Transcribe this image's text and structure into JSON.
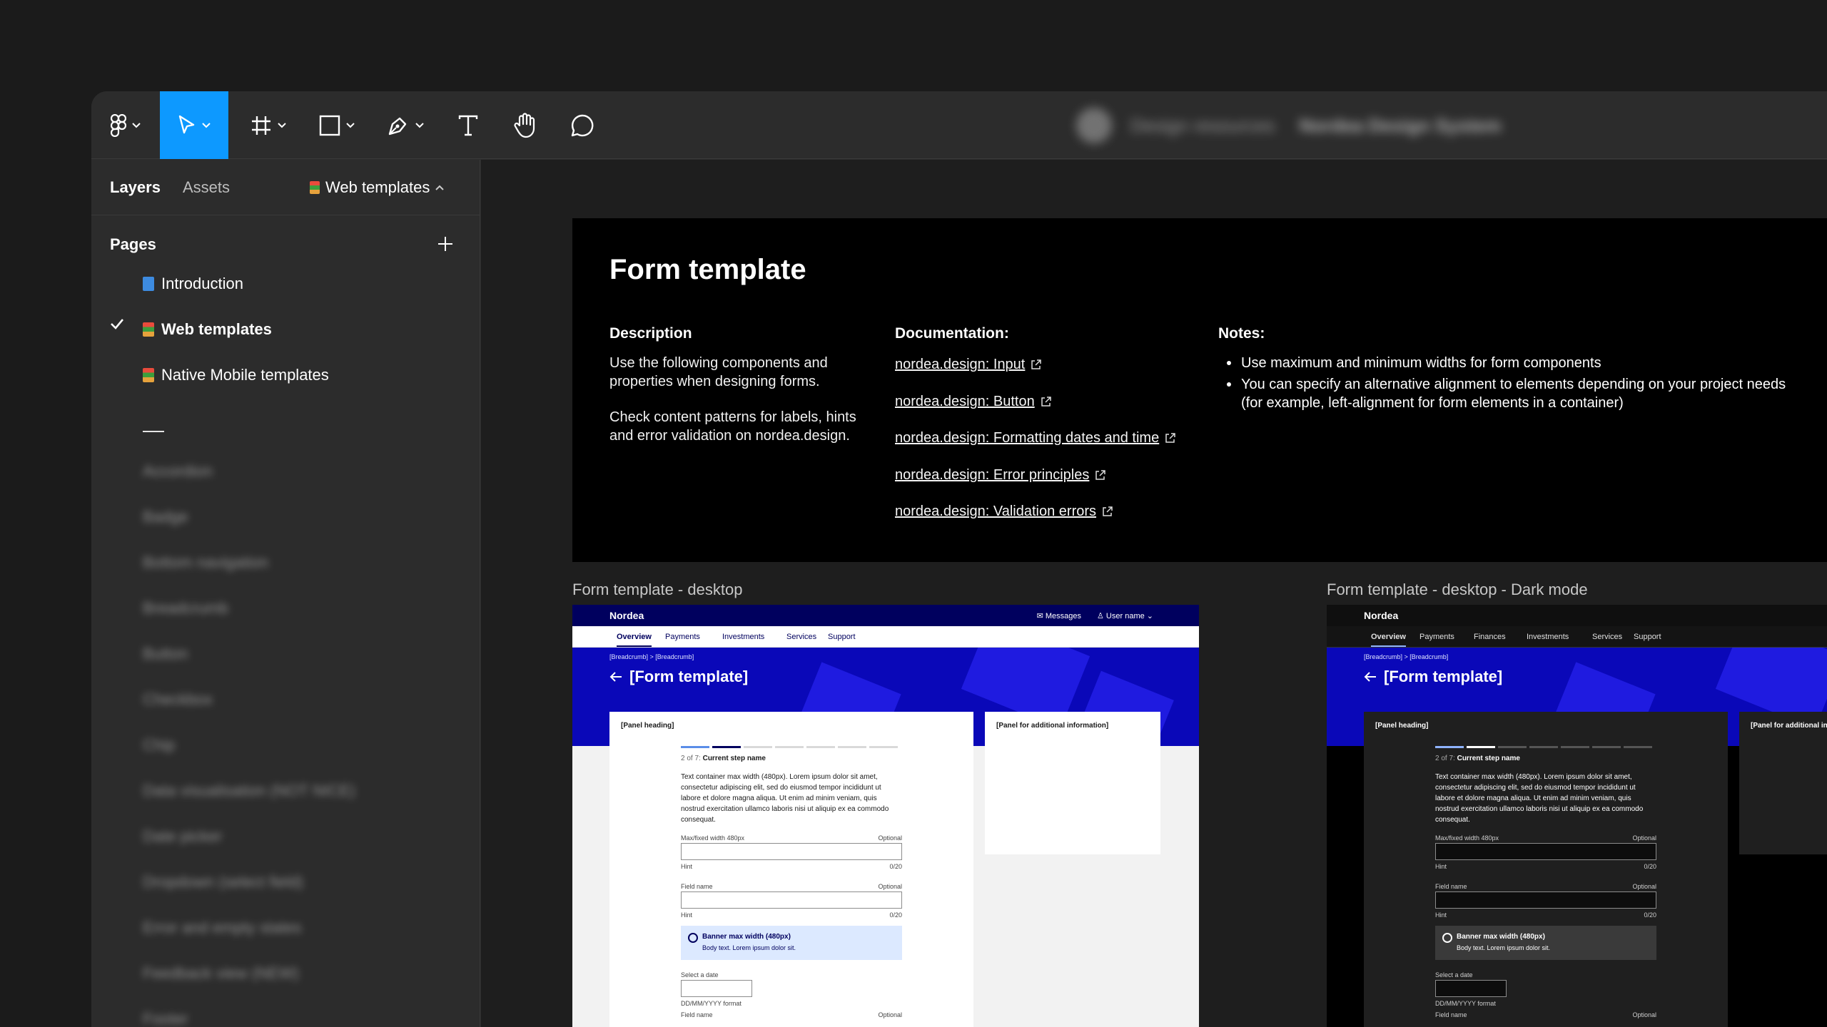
{
  "toolbar": {
    "tools": [
      {
        "name": "main-menu",
        "icon": "figma-logo-icon",
        "active": false
      },
      {
        "name": "move",
        "icon": "cursor-icon",
        "active": true
      },
      {
        "name": "frame",
        "icon": "frame-icon",
        "active": false
      },
      {
        "name": "shape",
        "icon": "rectangle-icon",
        "active": false
      },
      {
        "name": "pen",
        "icon": "pen-icon",
        "active": false
      },
      {
        "name": "text",
        "icon": "text-icon",
        "active": false
      },
      {
        "name": "hand",
        "icon": "hand-icon",
        "active": false
      },
      {
        "name": "comment",
        "icon": "comment-icon",
        "active": false
      }
    ],
    "accent_color": "#0d99ff",
    "file_team": "Design resources",
    "file_name": "Nordea Design System"
  },
  "sidebar": {
    "tab_layers": "Layers",
    "tab_assets": "Assets",
    "current_page": "Web templates",
    "pages_title": "Pages",
    "pages": [
      {
        "label": "Introduction",
        "selected": false
      },
      {
        "label": "Web templates",
        "selected": true
      },
      {
        "label": "Native Mobile templates",
        "selected": false
      }
    ],
    "separator": "—",
    "other_pages": [
      "Accordion",
      "Badge",
      "Bottom navigation",
      "Breadcrumb",
      "Button",
      "Checkbox",
      "Chip",
      "Data visualisation (NOT NICE)",
      "Date picker",
      "Dropdown (select field)",
      "Error and empty states",
      "Feedback view (NEW)",
      "Footer"
    ]
  },
  "doc": {
    "title": "Form template",
    "description_heading": "Description",
    "description_p1": "Use the following components and properties when designing forms.",
    "description_p2": "Check content patterns for labels, hints and error validation on nordea.design.",
    "documentation_heading": "Documentation:",
    "links": [
      "nordea.design: Input",
      "nordea.design: Button",
      "nordea.design: Formatting dates and time",
      "nordea.design: Error principles",
      "nordea.design: Validation errors"
    ],
    "notes_heading": "Notes:",
    "notes": [
      "Use maximum and minimum widths for form components",
      "You can specify an alternative alignment to elements depending on your project needs (for example, left-alignment for form elements in a container)"
    ]
  },
  "frames": {
    "desktop_label": "Form template - desktop",
    "dark_label": "Form template - desktop - Dark mode"
  },
  "preview": {
    "logo": "Nordea",
    "messages": "Messages",
    "user": "User name",
    "nav_light": [
      "Overview",
      "Payments",
      "Investments",
      "Services",
      "Support"
    ],
    "nav_dark": [
      "Overview",
      "Payments",
      "Finances",
      "Investments",
      "Services",
      "Support"
    ],
    "breadcrumb": "[Breadcrumb]  >  [Breadcrumb]",
    "page_title": "[Form template]",
    "panel_heading": "[Panel heading]",
    "side_heading": "[Panel for additional information]",
    "step_prefix": "2 of 7:",
    "step_name": "Current step name",
    "body_text": "Text container max width (480px). Lorem ipsum dolor sit amet, consectetur adipiscing elit, sed do eiusmod tempor incididunt ut labore et dolore magna aliqua. Ut enim ad minim veniam, quis nostrud exercitation ullamco laboris nisi ut aliquip ex ea commodo consequat.",
    "field1_label": "Max/fixed width 480px",
    "optional": "Optional",
    "hint": "Hint",
    "counter": "0/20",
    "field2_label": "Field name",
    "banner_title": "Banner max width (480px)",
    "banner_body": "Body text. Lorem ipsum dolor sit.",
    "date_label": "Select a date",
    "date_format": "DD/MM/YYYY format",
    "field3_label": "Field name"
  }
}
